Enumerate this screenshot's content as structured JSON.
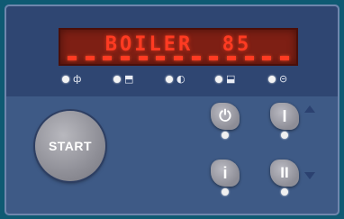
{
  "display": {
    "text": "BOILER  85"
  },
  "mode_indicators": [
    {
      "name": "fan-heat-icon",
      "glyph": "ф"
    },
    {
      "name": "bottom-heat-icon",
      "glyph": "⬒"
    },
    {
      "name": "steam-icon",
      "glyph": "◐"
    },
    {
      "name": "tray-heat-icon",
      "glyph": "⬓"
    },
    {
      "name": "grill-icon",
      "glyph": "⊝"
    }
  ],
  "controls": {
    "start_label": "START",
    "power_glyph": "⏻",
    "program1_glyph": "I",
    "info_glyph": "i",
    "program2_glyph": "II"
  },
  "colors": {
    "display_text": "#ff3b22",
    "panel": "#3e5a86"
  }
}
